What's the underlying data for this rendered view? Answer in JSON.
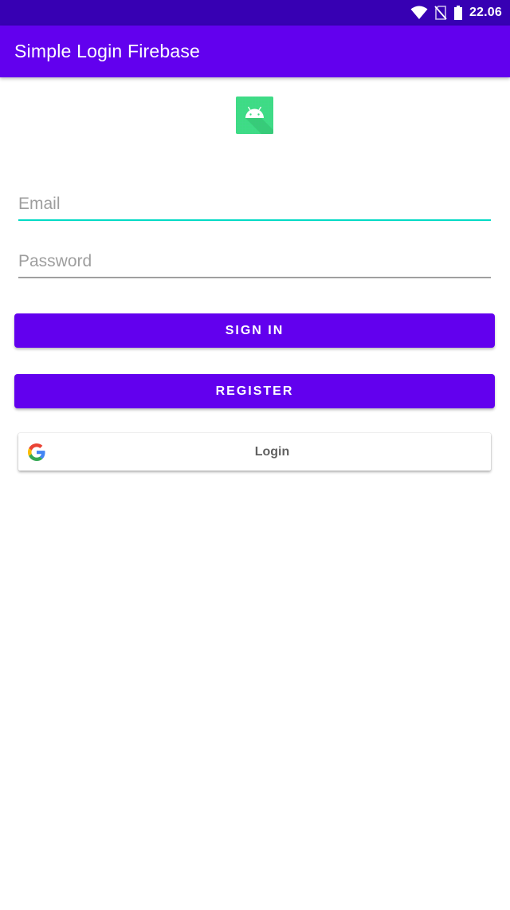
{
  "status_bar": {
    "time": "22.06",
    "icons": [
      "wifi-icon",
      "no-sim-icon",
      "battery-icon"
    ]
  },
  "app_bar": {
    "title": "Simple Login Firebase"
  },
  "logo": {
    "icon": "android-logo-icon"
  },
  "form": {
    "email": {
      "placeholder": "Email",
      "value": ""
    },
    "password": {
      "placeholder": "Password",
      "value": ""
    }
  },
  "buttons": {
    "sign_in": "SIGN IN",
    "register": "REGISTER",
    "google_login": "Login"
  },
  "colors": {
    "primary": "#6200ee",
    "primary_dark": "#3700b3",
    "accent": "#03dac5",
    "underline_inactive": "#9e9e9e"
  }
}
